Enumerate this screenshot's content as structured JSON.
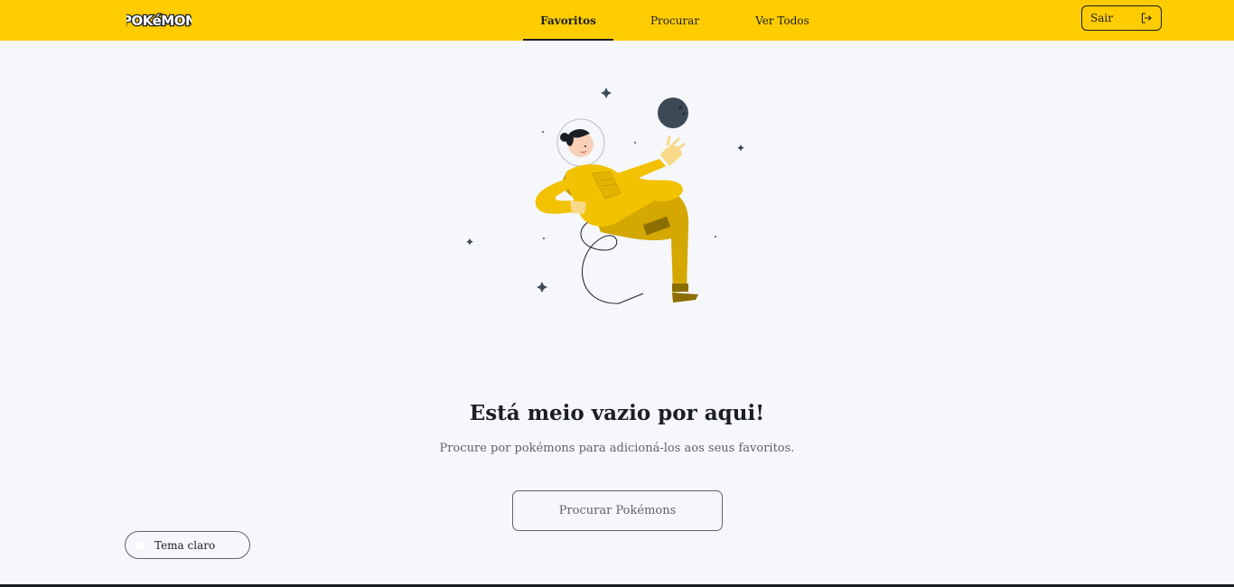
{
  "header": {
    "logo_text": "POKéMON",
    "tabs": [
      {
        "label": "Favoritos",
        "active": true
      },
      {
        "label": "Procurar",
        "active": false
      },
      {
        "label": "Ver Todos",
        "active": false
      }
    ],
    "logout_label": "Sair",
    "logout_icon": "logout-icon"
  },
  "empty_state": {
    "illustration": "astronaut-illustration",
    "title": "Está meio vazio por aqui!",
    "subtitle": "Procure por pokémons para adicioná-los aos seus favoritos.",
    "button_label": "Procurar Pokémons"
  },
  "theme_toggle": {
    "label": "Tema claro"
  },
  "colors": {
    "accent": "#ffcc00",
    "background": "#f5f7fb",
    "text": "#1b1f24",
    "muted": "#5f6368",
    "suit": "#f2c200",
    "planet": "#3d4a56"
  }
}
